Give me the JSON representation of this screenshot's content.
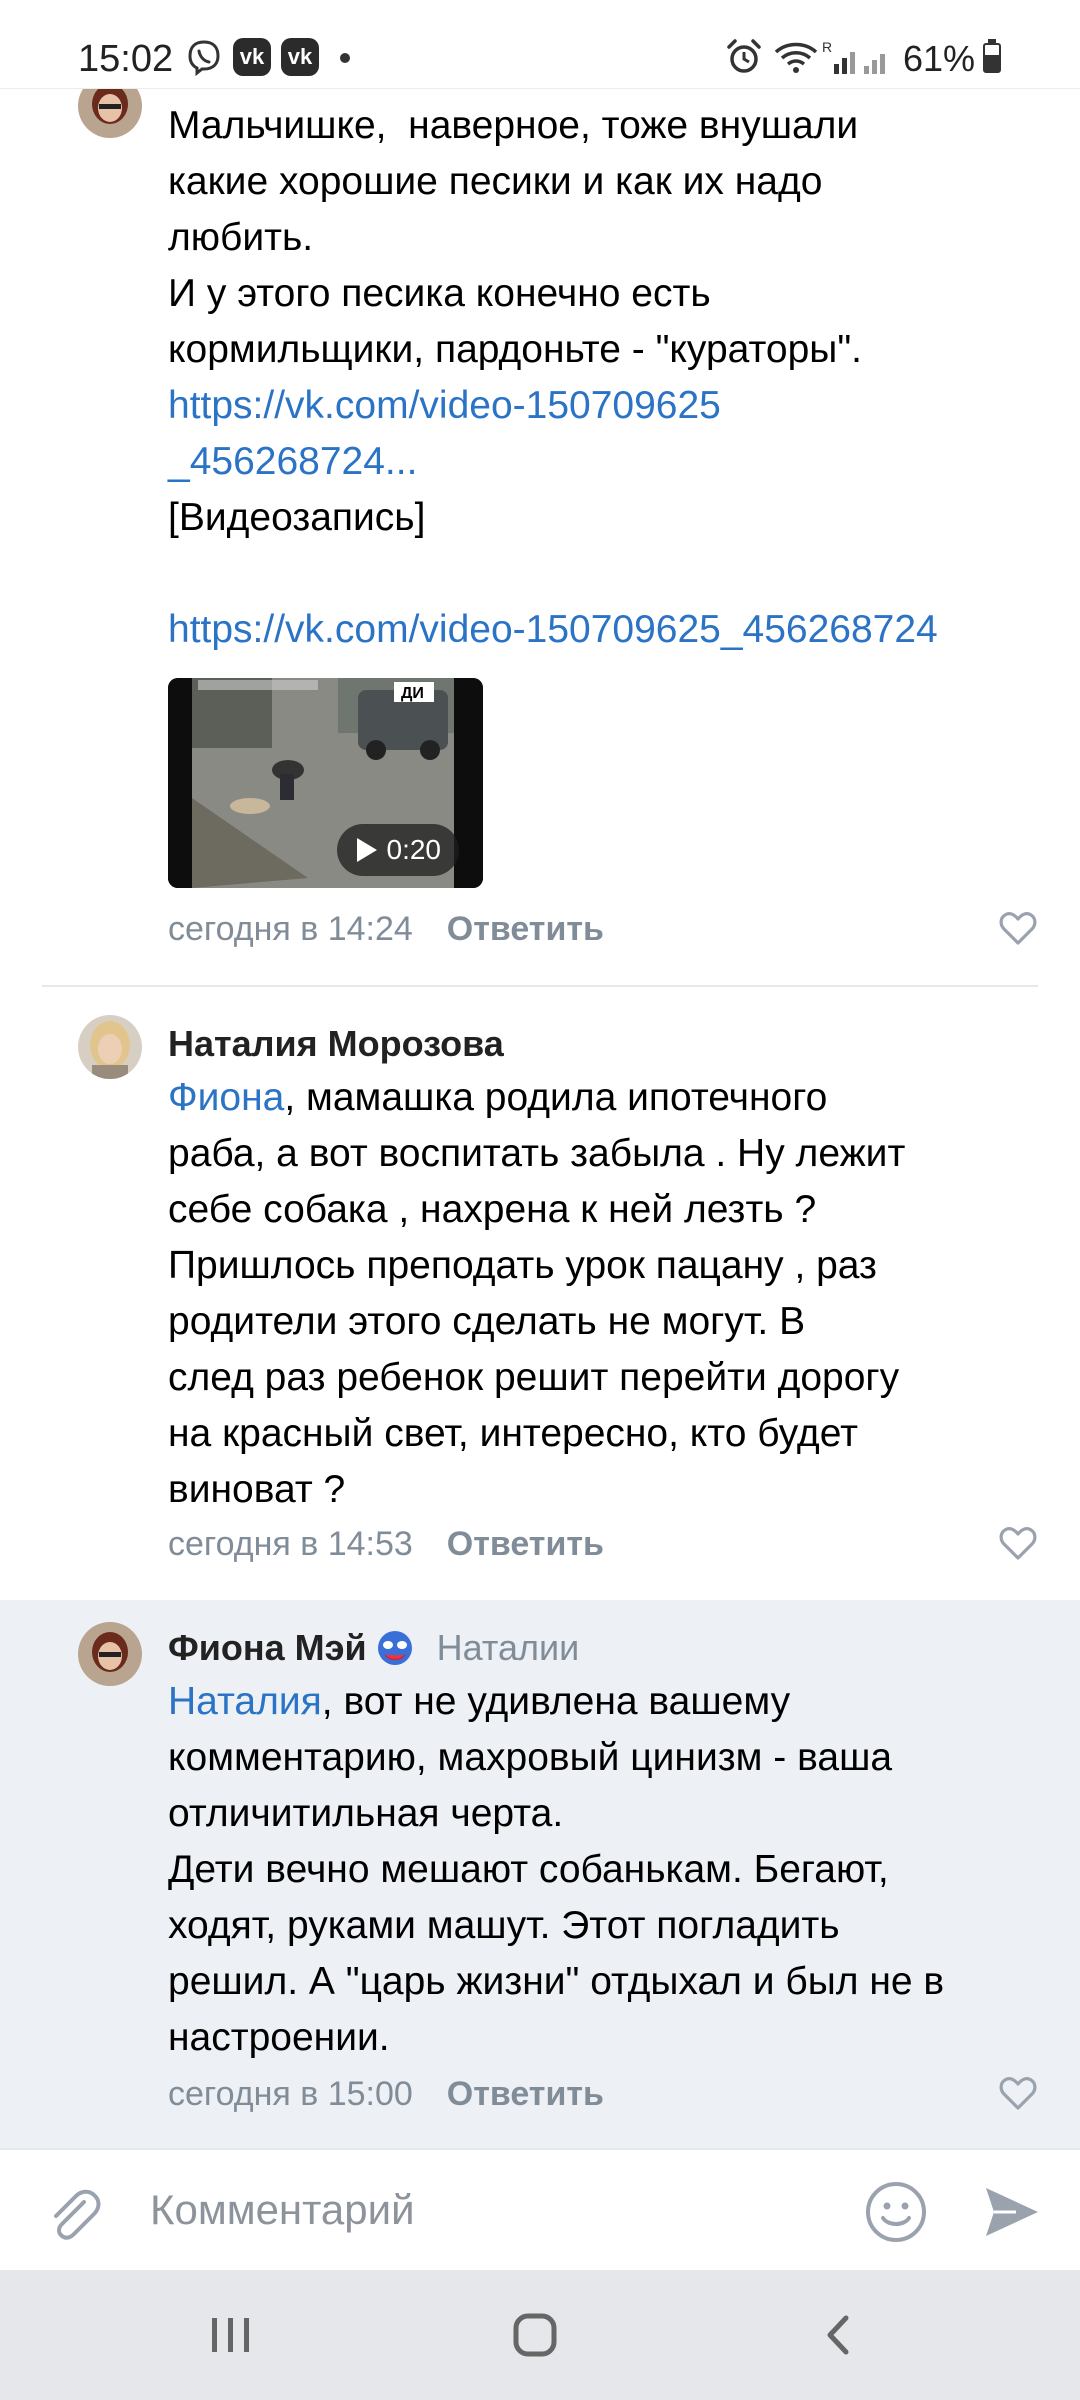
{
  "status_bar": {
    "time": "15:02",
    "battery": "61%",
    "battery_level": 0.61,
    "icons": [
      "viber-icon",
      "vk-icon",
      "vk-icon",
      "alarm-icon",
      "wifi-icon",
      "signal-icon"
    ]
  },
  "comments": [
    {
      "text_lines": [
        "Мальчишке,  наверное, тоже внушали",
        "какие хорошие песики и как их надо",
        "любить.",
        "И у этого песика конечно есть",
        "кормильщики, пардоньте - \"кураторы\"."
      ],
      "link_short_1": "https://vk.com/video-150709625",
      "link_short_2": "_456268724...",
      "video_label": "[Видеозапись]",
      "link_full": "https://vk.com/video-150709625_456268724",
      "video_duration": "0:20",
      "time": "сегодня в 14:24",
      "reply_label": "Ответить"
    },
    {
      "author": "Наталия Морозова",
      "mention": "Фиона",
      "text": ", мамашка родила ипотечного\nраба, а вот воспитать забыла . Ну лежит\nсебе собака , нахрена к ней лезть ?\nПришлось преподать урок пацану , раз\nродители этого сделать не могут. В\nслед раз ребенок решит перейти дорогу\nна красный свет, интересно, кто будет\nвиноват ?",
      "time": "сегодня в 14:53",
      "reply_label": "Ответить"
    },
    {
      "author": "Фиона Мэй",
      "reply_to": "Наталии",
      "mention": "Наталия",
      "text": ", вот не удивлена вашему\nкомментарию, махровый цинизм - ваша\nотличитильная черта.\nДети вечно мешают собанькам. Бегают,\nходят, руками машут. Этот погладить\nрешил. А \"царь жизни\" отдыхал и был не в\nнастроении.",
      "time": "сегодня в 15:00",
      "reply_label": "Ответить"
    }
  ],
  "composer": {
    "placeholder": "Комментарий"
  },
  "colors": {
    "link": "#2a73c5",
    "secondary_text": "#818c99",
    "highlight_bg": "#edf0f5"
  }
}
